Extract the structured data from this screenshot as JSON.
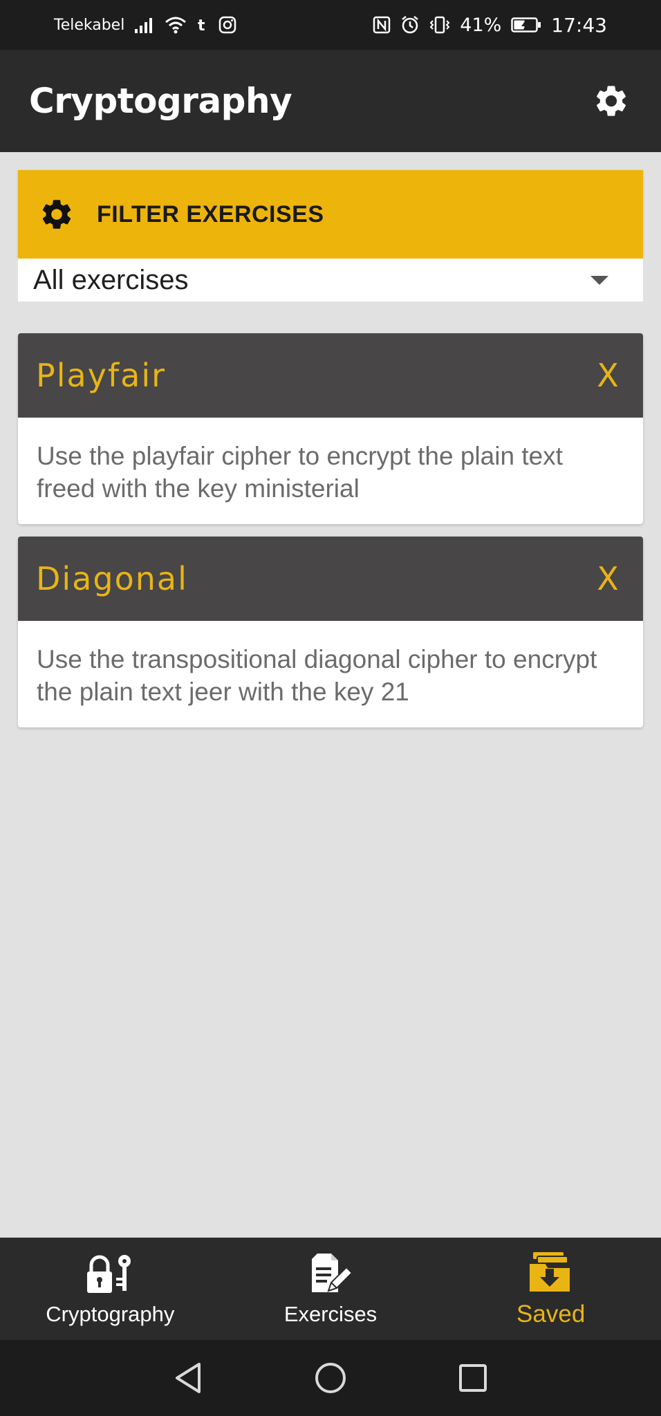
{
  "status_bar": {
    "carrier": "Telekabel",
    "battery_percent": "41%",
    "time": "17:43",
    "icons": [
      "signal-icon",
      "wifi-icon",
      "tumblr-icon",
      "instagram-icon",
      "nfc-icon",
      "alarm-icon",
      "vibrate-icon",
      "battery-icon"
    ]
  },
  "app_bar": {
    "title": "Cryptography",
    "settings_icon": "gear-icon"
  },
  "filter": {
    "title": "FILTER EXERCISES",
    "icon": "gear-icon",
    "selected": "All exercises"
  },
  "exercises": [
    {
      "title": "Playfair",
      "remove_label": "X",
      "description": "Use the playfair cipher to encrypt the plain text freed with the key ministerial"
    },
    {
      "title": "Diagonal",
      "remove_label": "X",
      "description": "Use the transpositional diagonal cipher to encrypt the plain text jeer with the key 21"
    }
  ],
  "bottom_nav": [
    {
      "label": "Cryptography",
      "icon": "lock-key-icon",
      "active": false
    },
    {
      "label": "Exercises",
      "icon": "document-edit-icon",
      "active": false
    },
    {
      "label": "Saved",
      "icon": "saved-download-icon",
      "active": true
    }
  ],
  "colors": {
    "accent": "#edb40b",
    "accent_text": "#e9b515",
    "app_bar": "#2b2b2b",
    "card_header": "#484647",
    "background": "#e1e1e1"
  }
}
